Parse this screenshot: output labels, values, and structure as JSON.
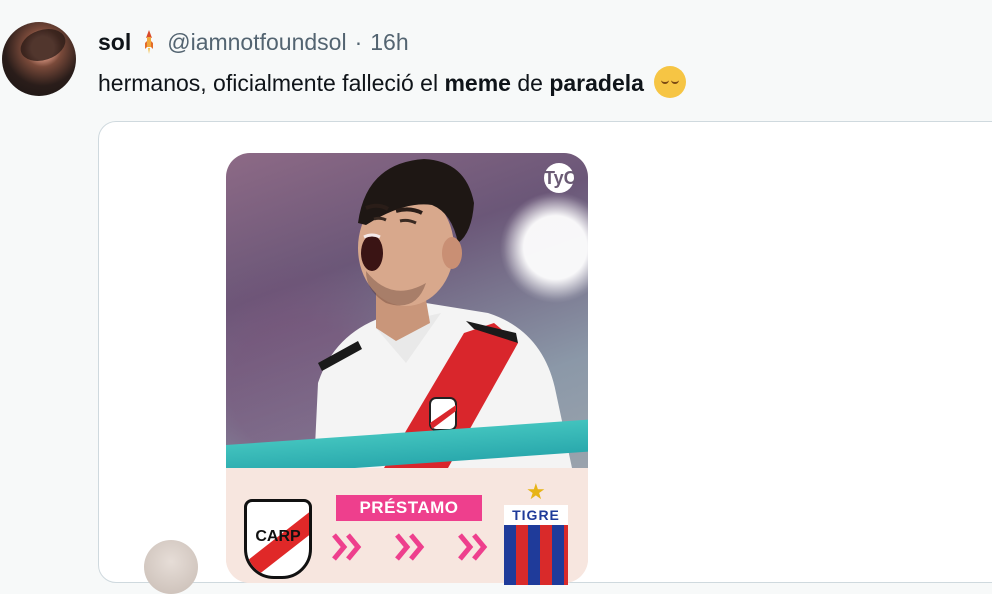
{
  "post": {
    "display_name": "sol",
    "handle": "@iamnotfoundsol",
    "separator": "·",
    "time": "16h",
    "text_parts": [
      "hermanos, oficialmente falleció el ",
      "meme",
      " de ",
      "paradela"
    ],
    "emoji": "relieved-face-emoji"
  },
  "quote": {
    "card": {
      "corner_logo": "TyC",
      "tag": "PRÉSTAMO",
      "to_club": "TIGRE",
      "from_club_letters": "CARP",
      "icons": [
        "corner-logo-icon",
        "river-plate-crest-icon",
        "chevron-right-icon",
        "star-icon",
        "tigre-crest-icon"
      ]
    }
  },
  "colors": {
    "name": "#0f1419",
    "meta": "#536471",
    "border": "#cfd9de",
    "tag_bg": "#ee3f8d",
    "teal": "#2aa9ad"
  }
}
